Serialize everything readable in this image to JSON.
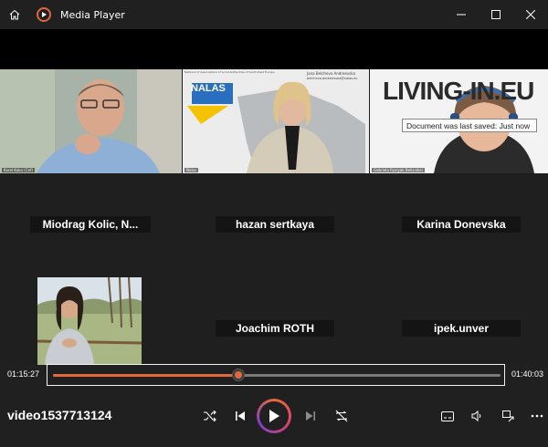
{
  "window": {
    "title": "Media Player",
    "icons": [
      "home-icon",
      "media-player-logo-icon",
      "minimize-icon",
      "maximize-icon",
      "close-icon"
    ]
  },
  "tooltip": {
    "text": "Document was last saved: Just now"
  },
  "tiles": {
    "left_name": "Karel Koko (Cef)",
    "center_name": "Nalas",
    "right_name": "Gabriela Rusiyak Belisnikei",
    "center_logo": "NALAS",
    "center_caption": "Network of Associations of Local Authorities of South-East Europe",
    "center_contact_name": "Jana Belcheva Andreevska",
    "center_contact_email": "belcheva.andreevska@nalas.eu",
    "right_banner": "LIVING-IN.EU"
  },
  "participants": [
    {
      "name": "Miodrag  Kolic, N..."
    },
    {
      "name": "hazan sertkaya"
    },
    {
      "name": "Karina Donevska"
    },
    {
      "name": "Joachim ROTH"
    },
    {
      "name": "ipek.unver"
    }
  ],
  "playback": {
    "elapsed": "01:15:27",
    "total": "01:40:03",
    "progress_percent": 41.5,
    "video_title": "video1537713124"
  },
  "colors": {
    "accent": "#e2693d",
    "background": "#202020"
  },
  "controls_icons": [
    "shuffle-icon",
    "previous-icon",
    "play-icon",
    "next-icon",
    "repeat-icon",
    "captions-icon",
    "volume-icon",
    "miniplayer-icon",
    "more-icon"
  ]
}
